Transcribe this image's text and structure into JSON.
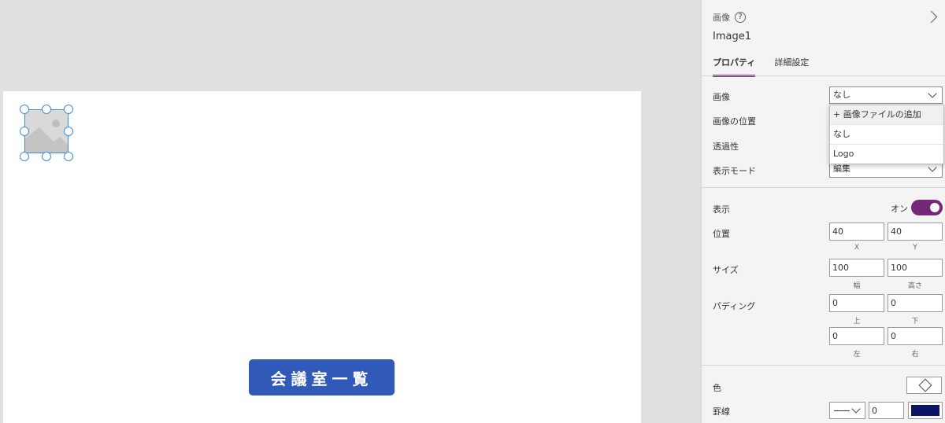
{
  "canvas": {
    "title_button_label": "会議室一覧"
  },
  "panel": {
    "control_type": "画像",
    "control_name": "Image1",
    "tabs": [
      {
        "label": "プロパティ",
        "active": true
      },
      {
        "label": "詳細設定",
        "active": false
      }
    ],
    "image": {
      "label": "画像",
      "value": "なし"
    },
    "dropdown_options": [
      "+ 画像ファイルの追加",
      "なし",
      "Logo"
    ],
    "image_position": {
      "label": "画像の位置"
    },
    "transparency": {
      "label": "透過性"
    },
    "display_mode": {
      "label": "表示モード",
      "value": "編集"
    },
    "visible": {
      "label": "表示",
      "value": "オン"
    },
    "position": {
      "label": "位置",
      "x": "40",
      "y": "40",
      "x_label": "X",
      "y_label": "Y"
    },
    "size": {
      "label": "サイズ",
      "width": "100",
      "height": "100",
      "width_label": "幅",
      "height_label": "高さ"
    },
    "padding": {
      "label": "パディング",
      "top": "0",
      "bottom": "0",
      "left": "0",
      "right": "0",
      "top_label": "上",
      "bottom_label": "下",
      "left_label": "左",
      "right_label": "右"
    },
    "color": {
      "label": "色"
    },
    "border": {
      "label": "罫線",
      "width": "0",
      "color": "#0b1566"
    }
  },
  "colors": {
    "accent": "#742774",
    "title_button_bg": "#3159b8",
    "selection": "#3c8fd6"
  }
}
